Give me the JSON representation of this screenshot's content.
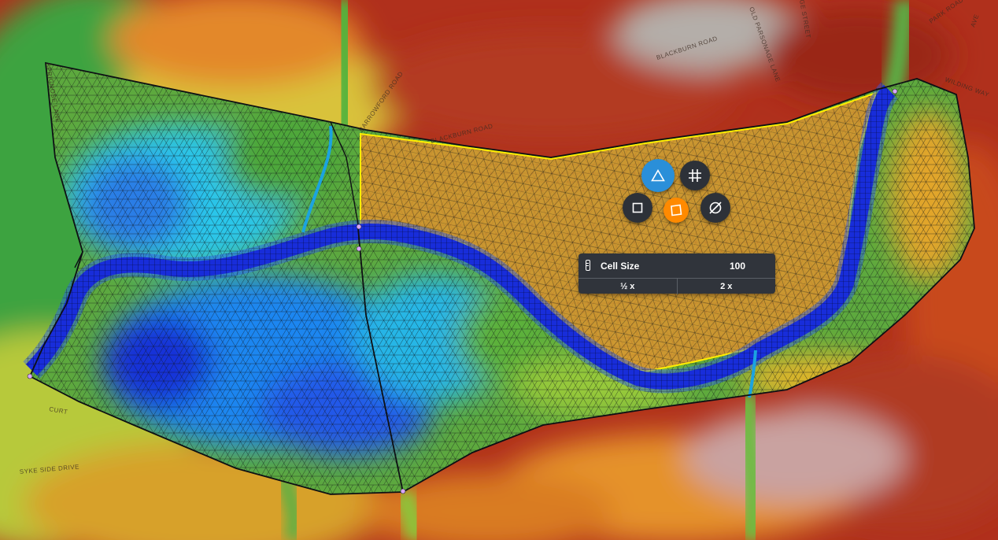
{
  "map": {
    "road_labels": [
      {
        "key": "barrowford",
        "text": "BARROWFORD ROAD"
      },
      {
        "key": "blackburn1",
        "text": "BLACKBURN ROAD"
      },
      {
        "key": "blackburn2",
        "text": "BLACKBURN ROAD"
      },
      {
        "key": "old_parsonage",
        "text": "OLD PARSONAGE LANE"
      },
      {
        "key": "street",
        "text": "GE STREET"
      },
      {
        "key": "park_rd",
        "text": "PARK ROAD"
      },
      {
        "key": "wilding",
        "text": "WILDING WAY"
      },
      {
        "key": "sykeside",
        "text": "SYKE SIDE DRIVE"
      },
      {
        "key": "sprignose",
        "text": "SPRIGNOSE LANE"
      },
      {
        "key": "curt",
        "text": "CURT"
      },
      {
        "key": "ave",
        "text": "AVE"
      }
    ]
  },
  "toolbar": {
    "triangle_mesh": "triangle-icon",
    "grid_mesh": "grid-icon",
    "square_mesh": "square-icon",
    "quad_mesh": "quad-icon",
    "no_mesh": "empty-set-icon"
  },
  "cell_panel": {
    "label": "Cell Size",
    "value": "100",
    "half_label": "½ x",
    "double_label": "2 x"
  },
  "colors": {
    "accent_blue": "#2a8fd9",
    "accent_orange": "#ff8a00",
    "selection_yellow": "#ffee00",
    "panel_bg": "#30343b"
  }
}
